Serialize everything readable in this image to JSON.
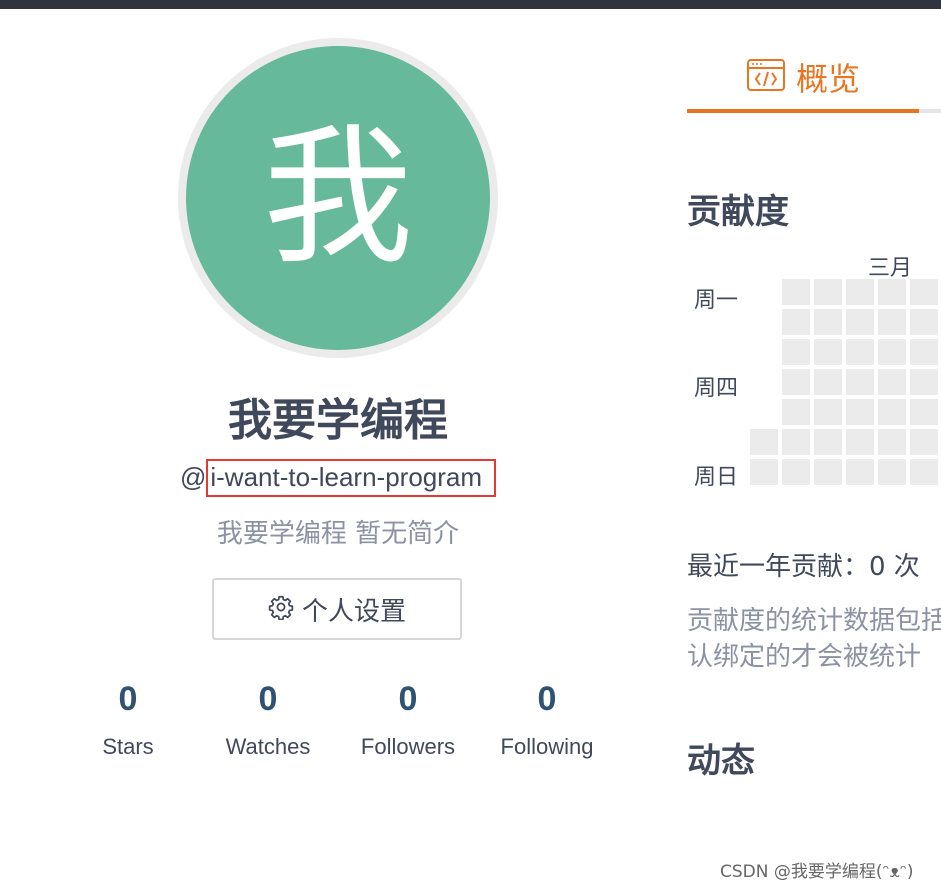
{
  "profile": {
    "avatar_char": "我",
    "avatar_color": "#66b99b",
    "display_name": "我要学编程",
    "username_prefix": "@",
    "username": "i-want-to-learn-program",
    "bio": "我要学编程 暂无简介",
    "settings_label": "个人设置",
    "settings_icon": "gear-icon"
  },
  "stats": [
    {
      "value": "0",
      "label": "Stars"
    },
    {
      "value": "0",
      "label": "Watches"
    },
    {
      "value": "0",
      "label": "Followers"
    },
    {
      "value": "0",
      "label": "Following"
    }
  ],
  "tabs": {
    "overview_label": "概览",
    "overview_icon": "code-window-icon",
    "accent_color": "#e97520"
  },
  "contributions": {
    "title": "贡献度",
    "month_label": "三月",
    "day_labels": [
      "周一",
      "周四",
      "周日"
    ],
    "total_text": "最近一年贡献：0 次",
    "note_line1": "贡献度的统计数据包括",
    "note_line2": "认绑定的才会被统计"
  },
  "activity": {
    "title": "动态"
  },
  "watermark": "CSDN @我要学编程(ᵔᴥᵔ)"
}
